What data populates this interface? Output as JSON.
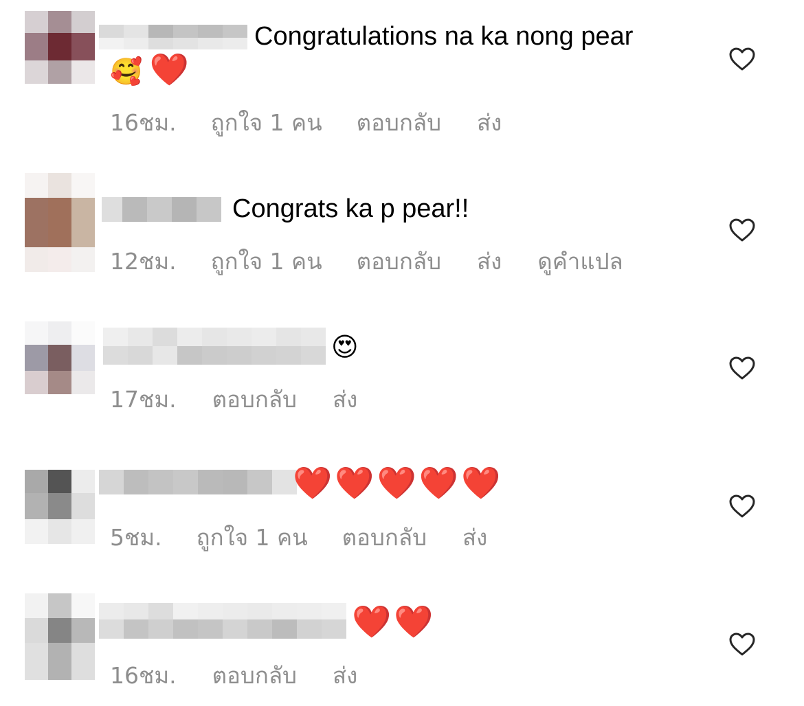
{
  "comments": [
    {
      "text": "Congratulations na ka nong pear",
      "emojis": [
        "🥰",
        "❤️"
      ],
      "time": "16ชม.",
      "likes": "ถูกใจ 1 คน",
      "reply": "ตอบกลับ",
      "send": "ส่ง"
    },
    {
      "text": "Congrats ka p pear!!",
      "time": "12ชม.",
      "likes": "ถูกใจ 1 คน",
      "reply": "ตอบกลับ",
      "send": "ส่ง",
      "translate": "ดูคำแปล"
    },
    {
      "emojis": [
        "😍"
      ],
      "time": "17ชม.",
      "reply": "ตอบกลับ",
      "send": "ส่ง"
    },
    {
      "emojis": [
        "❤️",
        "❤️",
        "❤️",
        "❤️",
        "❤️"
      ],
      "time": "5ชม.",
      "likes": "ถูกใจ 1 คน",
      "reply": "ตอบกลับ",
      "send": "ส่ง"
    },
    {
      "emojis": [
        "❤️",
        "❤️"
      ],
      "time": "16ชม.",
      "reply": "ตอบกลับ",
      "send": "ส่ง"
    }
  ],
  "icons": {
    "like": "heart-outline-icon"
  },
  "colors": {
    "meta_text": "#8e8e8e",
    "heart_red": "#e0202a",
    "like_icon_stroke": "#262626"
  }
}
